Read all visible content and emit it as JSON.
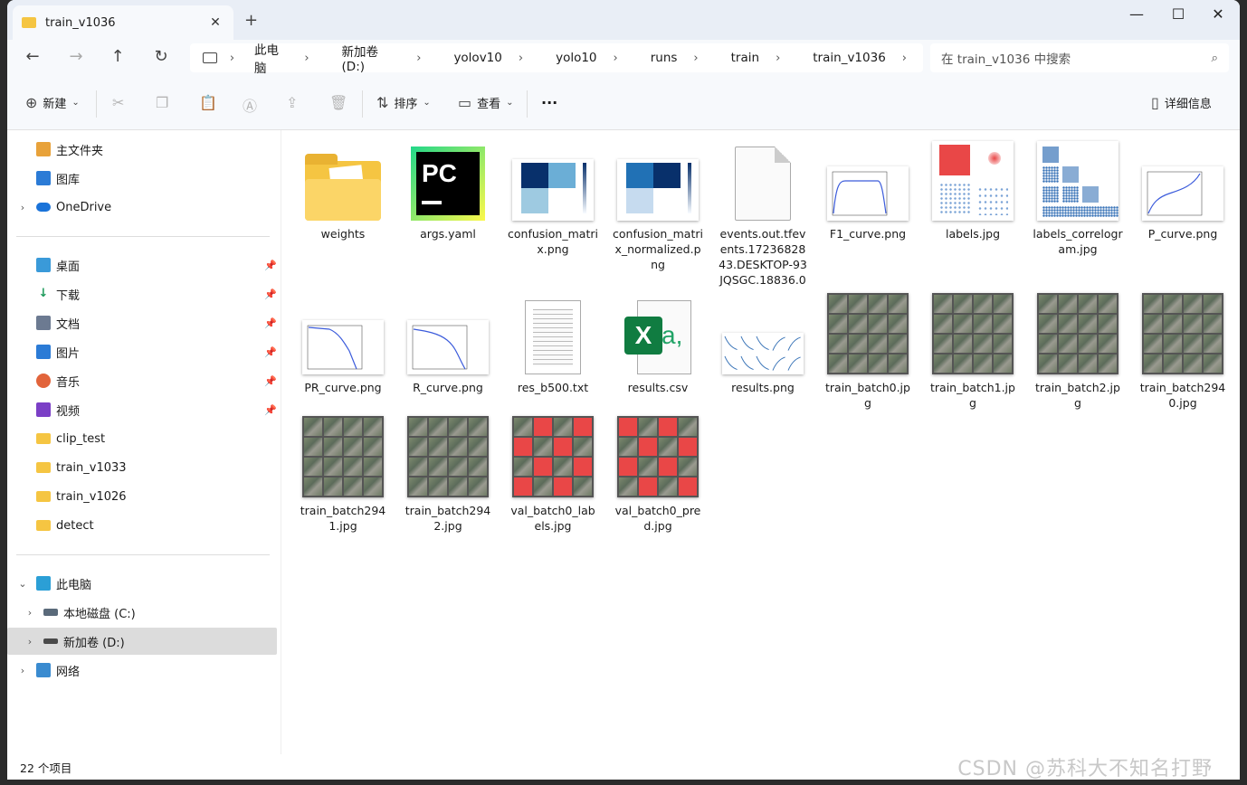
{
  "window": {
    "tab_title": "train_v1036",
    "tab_close": "✕",
    "newtab": "+",
    "minimize": "—",
    "maximize": "☐",
    "close": "✕"
  },
  "nav": {
    "back": "←",
    "forward": "→",
    "up": "↑",
    "refresh": "↻"
  },
  "breadcrumb": [
    "此电脑",
    "新加卷 (D:)",
    "yolov10",
    "yolo10",
    "runs",
    "train",
    "train_v1036"
  ],
  "search": {
    "placeholder": "在 train_v1036 中搜索"
  },
  "toolbar": {
    "new": "新建",
    "sort": "排序",
    "view": "查看",
    "more": "···",
    "details": "详细信息"
  },
  "sidebar": {
    "quick": [
      {
        "label": "主文件夹",
        "icon": "home-icon"
      },
      {
        "label": "图库",
        "icon": "gallery-icon"
      },
      {
        "label": "OneDrive",
        "icon": "cloud-icon"
      }
    ],
    "pinned": [
      {
        "label": "桌面",
        "icon": "desktop-icon"
      },
      {
        "label": "下载",
        "icon": "download-icon"
      },
      {
        "label": "文档",
        "icon": "document-icon"
      },
      {
        "label": "图片",
        "icon": "pictures-icon"
      },
      {
        "label": "音乐",
        "icon": "music-icon"
      },
      {
        "label": "视频",
        "icon": "video-icon"
      },
      {
        "label": "clip_test",
        "icon": "folder-icon"
      },
      {
        "label": "train_v1033",
        "icon": "folder-icon"
      },
      {
        "label": "train_v1026",
        "icon": "folder-icon"
      },
      {
        "label": "detect",
        "icon": "folder-icon"
      }
    ],
    "pc": [
      {
        "label": "此电脑",
        "icon": "pc-icon"
      },
      {
        "label": "本地磁盘 (C:)",
        "icon": "drive-icon"
      },
      {
        "label": "新加卷 (D:)",
        "icon": "drive-icon"
      },
      {
        "label": "网络",
        "icon": "network-icon"
      }
    ]
  },
  "files": [
    {
      "name": "weights",
      "kind": "folder"
    },
    {
      "name": "args.yaml",
      "kind": "pycharm"
    },
    {
      "name": "confusion_matrix.png",
      "kind": "matrix"
    },
    {
      "name": "confusion_matrix_normalized.png",
      "kind": "matrix2"
    },
    {
      "name": "events.out.tfevents.1723682843.DESKTOP-93JQSGC.18836.0",
      "kind": "blank"
    },
    {
      "name": "F1_curve.png",
      "kind": "curve"
    },
    {
      "name": "labels.jpg",
      "kind": "labels"
    },
    {
      "name": "labels_correlogram.jpg",
      "kind": "correlogram"
    },
    {
      "name": "P_curve.png",
      "kind": "curve"
    },
    {
      "name": "PR_curve.png",
      "kind": "curve"
    },
    {
      "name": "R_curve.png",
      "kind": "curve"
    },
    {
      "name": "res_b500.txt",
      "kind": "text"
    },
    {
      "name": "results.csv",
      "kind": "excel"
    },
    {
      "name": "results.png",
      "kind": "results"
    },
    {
      "name": "train_batch0.jpg",
      "kind": "photo"
    },
    {
      "name": "train_batch1.jpg",
      "kind": "photo"
    },
    {
      "name": "train_batch2.jpg",
      "kind": "photo"
    },
    {
      "name": "train_batch2940.jpg",
      "kind": "photo"
    },
    {
      "name": "train_batch2941.jpg",
      "kind": "photo"
    },
    {
      "name": "train_batch2942.jpg",
      "kind": "photo"
    },
    {
      "name": "val_batch0_labels.jpg",
      "kind": "photo"
    },
    {
      "name": "val_batch0_pred.jpg",
      "kind": "photo"
    }
  ],
  "status": {
    "count": "22 个项目"
  },
  "watermark": "CSDN @苏科大不知名打野",
  "colors": {
    "accent": "#0067c0",
    "selected": "#dcdcdc",
    "folder": "#f5c542"
  }
}
